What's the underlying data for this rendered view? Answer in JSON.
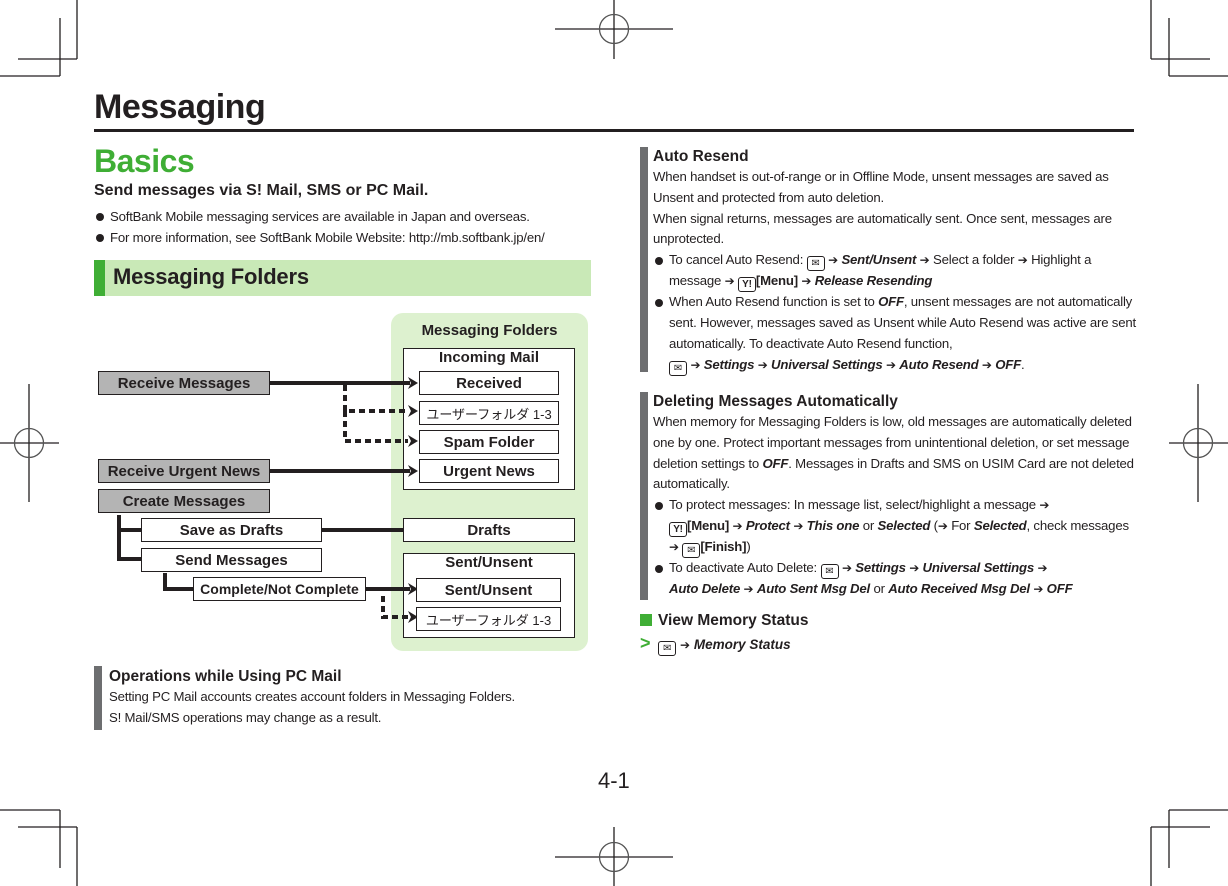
{
  "header": {
    "chapter_title": "Messaging",
    "page_number": "4-1"
  },
  "basics": {
    "title": "Basics",
    "lead": "Send messages via S! Mail, SMS or PC Mail.",
    "bullets": [
      "SoftBank Mobile messaging services are available in Japan and overseas.",
      "For more information, see SoftBank Mobile Website: http://mb.softbank.jp/en/"
    ]
  },
  "folders_section": {
    "title": "Messaging Folders",
    "diagram": {
      "panel_title": "Messaging Folders",
      "sources": {
        "receive_messages": "Receive Messages",
        "receive_urgent_news": "Receive Urgent News",
        "create_messages": "Create Messages",
        "save_as_drafts": "Save as Drafts",
        "send_messages": "Send Messages",
        "complete_not_complete": "Complete/Not Complete"
      },
      "incoming": {
        "label": "Incoming Mail",
        "received": "Received",
        "user_folder": "ユーザーフォルダ 1-3",
        "spam": "Spam Folder",
        "urgent_news": "Urgent News"
      },
      "drafts": "Drafts",
      "sent": {
        "label": "Sent/Unsent",
        "sent_unsent": "Sent/Unsent",
        "user_folder": "ユーザーフォルダ 1-3"
      }
    },
    "note": {
      "title": "Operations while Using PC Mail",
      "lines": [
        "Setting PC Mail accounts creates account folders in Messaging Folders.",
        "S! Mail/SMS operations may change as a result."
      ]
    }
  },
  "auto_resend": {
    "title": "Auto Resend",
    "paragraphs": [
      "When handset is out-of-range or in Offline Mode, unsent messages are saved as Unsent and protected from auto deletion.",
      "When signal returns, messages are automatically sent. Once sent, messages are unprotected."
    ],
    "bullet1": {
      "prefix": "To cancel Auto Resend:",
      "sent_unsent": "Sent/Unsent",
      "select_folder": "Select a folder",
      "highlight": "Highlight a message",
      "menu": "[Menu]",
      "release": "Release Resending"
    },
    "bullet2": {
      "text1": "When Auto Resend function is set to",
      "off": "OFF",
      "text2": ", unsent messages are not automatically sent. However, messages saved as Unsent while Auto Resend was active are sent automatically. To deactivate Auto Resend function,",
      "settings": "Settings",
      "universal": "Universal Settings",
      "auto_resend": "Auto Resend",
      "off2": "OFF"
    }
  },
  "auto_delete": {
    "title": "Deleting Messages Automatically",
    "para1": "When memory for Messaging Folders is low, old messages are automatically deleted one by one. Protect important messages from unintentional deletion, or set message deletion settings to",
    "off": "OFF",
    "para2": ". Messages in Drafts and SMS on USIM Card are not deleted automatically.",
    "bullet1": {
      "prefix": "To protect messages: In message list, select/highlight a message",
      "menu": "[Menu]",
      "protect": "Protect",
      "this_one": "This one",
      "or": "or",
      "selected": "Selected",
      "for_text": "For",
      "selected2": "Selected",
      "check": ", check messages",
      "finish": "[Finish]"
    },
    "bullet2": {
      "prefix": "To deactivate Auto Delete:",
      "settings": "Settings",
      "universal": "Universal Settings",
      "auto_delete": "Auto Delete",
      "sent_del": "Auto Sent Msg Del",
      "or": "or",
      "received_del": "Auto Received Msg Del",
      "off": "OFF"
    }
  },
  "memory_status": {
    "title": "View Memory Status",
    "step": "Memory Status"
  },
  "icons": {
    "mail_key": "✉",
    "yahoo_key": "Y!",
    "arrow": "➔",
    "step_marker": ">"
  },
  "colors": {
    "accent_green": "#3fae35",
    "light_green": "#c9e9b7",
    "panel_green": "#ddf1cf",
    "note_bar_gray": "#6d6e70",
    "node_gray": "#b4b4b4"
  }
}
